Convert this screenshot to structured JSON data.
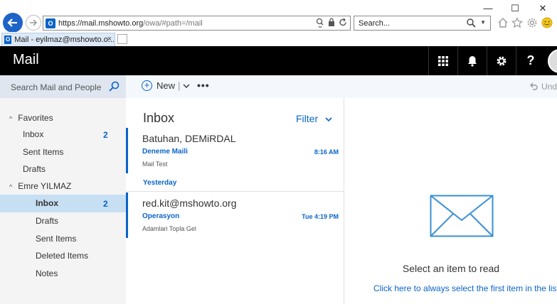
{
  "browser": {
    "window_controls": [
      "—",
      "☐",
      "✕"
    ],
    "address": {
      "prefix": "https://",
      "host": "mail.mshowto.org",
      "path": "/owa/#path=/mail"
    },
    "search": {
      "placeholder": "Search..."
    },
    "tab": {
      "title": "Mail - eyilmaz@mshowto.o...",
      "close": "×"
    },
    "icons": [
      "home-icon",
      "favorites-star-icon",
      "settings-gear-icon",
      "smiley-icon"
    ]
  },
  "header": {
    "app_title": "Mail",
    "buttons": [
      "app-launcher-icon",
      "notifications-bell-icon",
      "settings-gear-icon",
      "help-icon"
    ],
    "help_label": "?"
  },
  "leftnav": {
    "search_placeholder": "Search Mail and People",
    "favorites_label": "Favorites",
    "favorites": [
      {
        "label": "Inbox",
        "count": "2"
      },
      {
        "label": "Sent Items"
      },
      {
        "label": "Drafts"
      }
    ],
    "account_label": "Emre YILMAZ",
    "folders": [
      {
        "label": "Inbox",
        "count": "2",
        "selected": true
      },
      {
        "label": "Drafts"
      },
      {
        "label": "Sent Items"
      },
      {
        "label": "Deleted Items"
      },
      {
        "label": "Notes"
      }
    ]
  },
  "commandbar": {
    "new_label": "New",
    "more_label": "•••",
    "undo_label": "Und"
  },
  "msglist": {
    "title": "Inbox",
    "filter_label": "Filter",
    "group_label": "Yesterday",
    "messages": [
      {
        "sender": "Batuhan, DEMiRDAL",
        "subject": "Deneme Maili",
        "time": "8:16 AM",
        "preview": "Mail Test"
      },
      {
        "sender": "red.kit@mshowto.org",
        "subject": "Operasyon",
        "time": "Tue 4:19 PM",
        "preview": "Adamlari Topla Gel"
      }
    ]
  },
  "reading": {
    "prompt": "Select an item to read",
    "link": "Click here to always select the first item in the list"
  },
  "colors": {
    "accent": "#0a64c8",
    "header_bg": "#000000",
    "nav_bg": "#f4f4f4",
    "selected_bg": "#c7dff3"
  }
}
